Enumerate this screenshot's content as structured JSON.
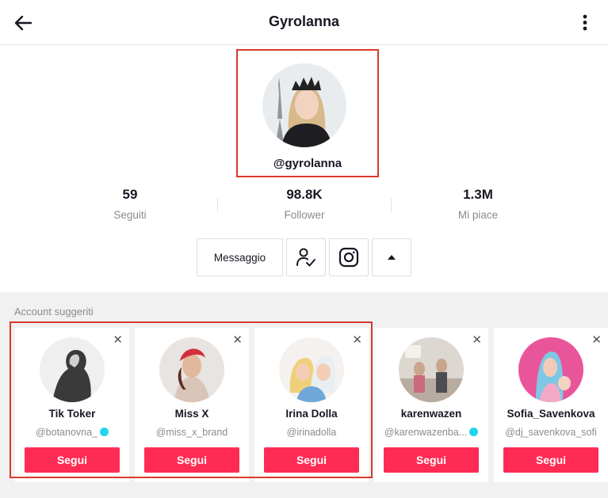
{
  "header": {
    "title": "Gyrolanna",
    "back_icon": "arrow-left-icon",
    "more_icon": "more-vertical-icon"
  },
  "profile": {
    "handle": "@gyrolanna",
    "stats": [
      {
        "value": "59",
        "label": "Seguiti"
      },
      {
        "value": "98.8K",
        "label": "Follower"
      },
      {
        "value": "1.3M",
        "label": "Mi piace"
      }
    ]
  },
  "actions": {
    "message_label": "Messaggio",
    "following_icon": "user-check-icon",
    "instagram_icon": "instagram-icon",
    "expand_icon": "caret-up-icon"
  },
  "suggested": {
    "title": "Account suggeriti",
    "close_glyph": "✕",
    "follow_label": "Segui",
    "accounts": [
      {
        "name": "Tik Toker",
        "handle": "@botanovna_",
        "verified": true
      },
      {
        "name": "Miss X",
        "handle": "@miss_x_brand",
        "verified": false
      },
      {
        "name": "Irina Dolla",
        "handle": "@irinadolla",
        "verified": false
      },
      {
        "name": "karenwazen",
        "handle": "@karenwazenba...",
        "verified": true
      },
      {
        "name": "Sofia_Savenkova",
        "handle": "@dj_savenkova_sofi",
        "verified": false
      }
    ]
  },
  "colors": {
    "accent": "#fe2c55",
    "highlight_frame": "#d93a2b",
    "verified": "#20d5ec"
  }
}
